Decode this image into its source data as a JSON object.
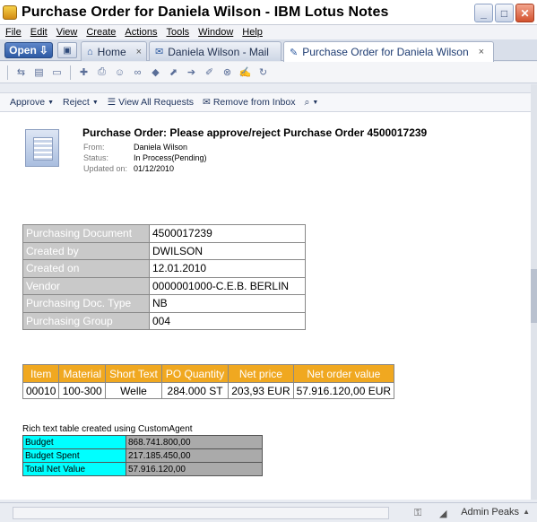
{
  "window": {
    "title": "Purchase Order for Daniela Wilson - IBM Lotus Notes",
    "buttons": {
      "minimize": "_",
      "maximize": "□",
      "close": "✕"
    }
  },
  "menu": [
    "File",
    "Edit",
    "View",
    "Create",
    "Actions",
    "Tools",
    "Window",
    "Help"
  ],
  "tabs": {
    "open_label": "Open",
    "items": [
      {
        "label": "Home"
      },
      {
        "label": "Daniela Wilson - Mail"
      },
      {
        "label": "Purchase Order for Daniela Wilson"
      }
    ],
    "close_glyph": "×"
  },
  "actions": {
    "approve": "Approve",
    "reject": "Reject",
    "view_all": "View All Requests",
    "remove": "Remove from Inbox"
  },
  "document": {
    "title": "Purchase Order: Please approve/reject Purchase Order 4500017239",
    "from_label": "From:",
    "from_value": "Daniela Wilson",
    "status_label": "Status:",
    "status_value": "In Process(Pending)",
    "updated_label": "Updated on:",
    "updated_value": "01/12/2010"
  },
  "info_table": [
    {
      "label": "Purchasing Document",
      "value": "4500017239"
    },
    {
      "label": "Created by",
      "value": "DWILSON"
    },
    {
      "label": "Created on",
      "value": "12.01.2010"
    },
    {
      "label": "Vendor",
      "value": "0000001000-C.E.B. BERLIN"
    },
    {
      "label": "Purchasing Doc. Type",
      "value": "NB"
    },
    {
      "label": "Purchasing Group",
      "value": "004"
    }
  ],
  "po_table": {
    "headers": [
      "Item",
      "Material",
      "Short Text",
      "PO Quantity",
      "Net price",
      "Net order value"
    ],
    "rows": [
      [
        "00010",
        "100-300",
        "Welle",
        "284.000 ST",
        "203,93 EUR",
        "57.916.120,00 EUR"
      ]
    ]
  },
  "rich_text": {
    "caption": "Rich text table created using CustomAgent",
    "rows": [
      {
        "label": "Budget",
        "value": "868.741.800,00"
      },
      {
        "label": "Budget Spent",
        "value": "217.185.450,00"
      },
      {
        "label": "Total Net Value",
        "value": "57.916.120,00"
      }
    ]
  },
  "status": {
    "user": "Admin Peaks"
  },
  "colors": {
    "info_label_bg": "#c9c9c9",
    "po_header_bg": "#f0a820",
    "rt_label_bg": "#00ffff",
    "rt_value_bg": "#aaaaaa"
  }
}
